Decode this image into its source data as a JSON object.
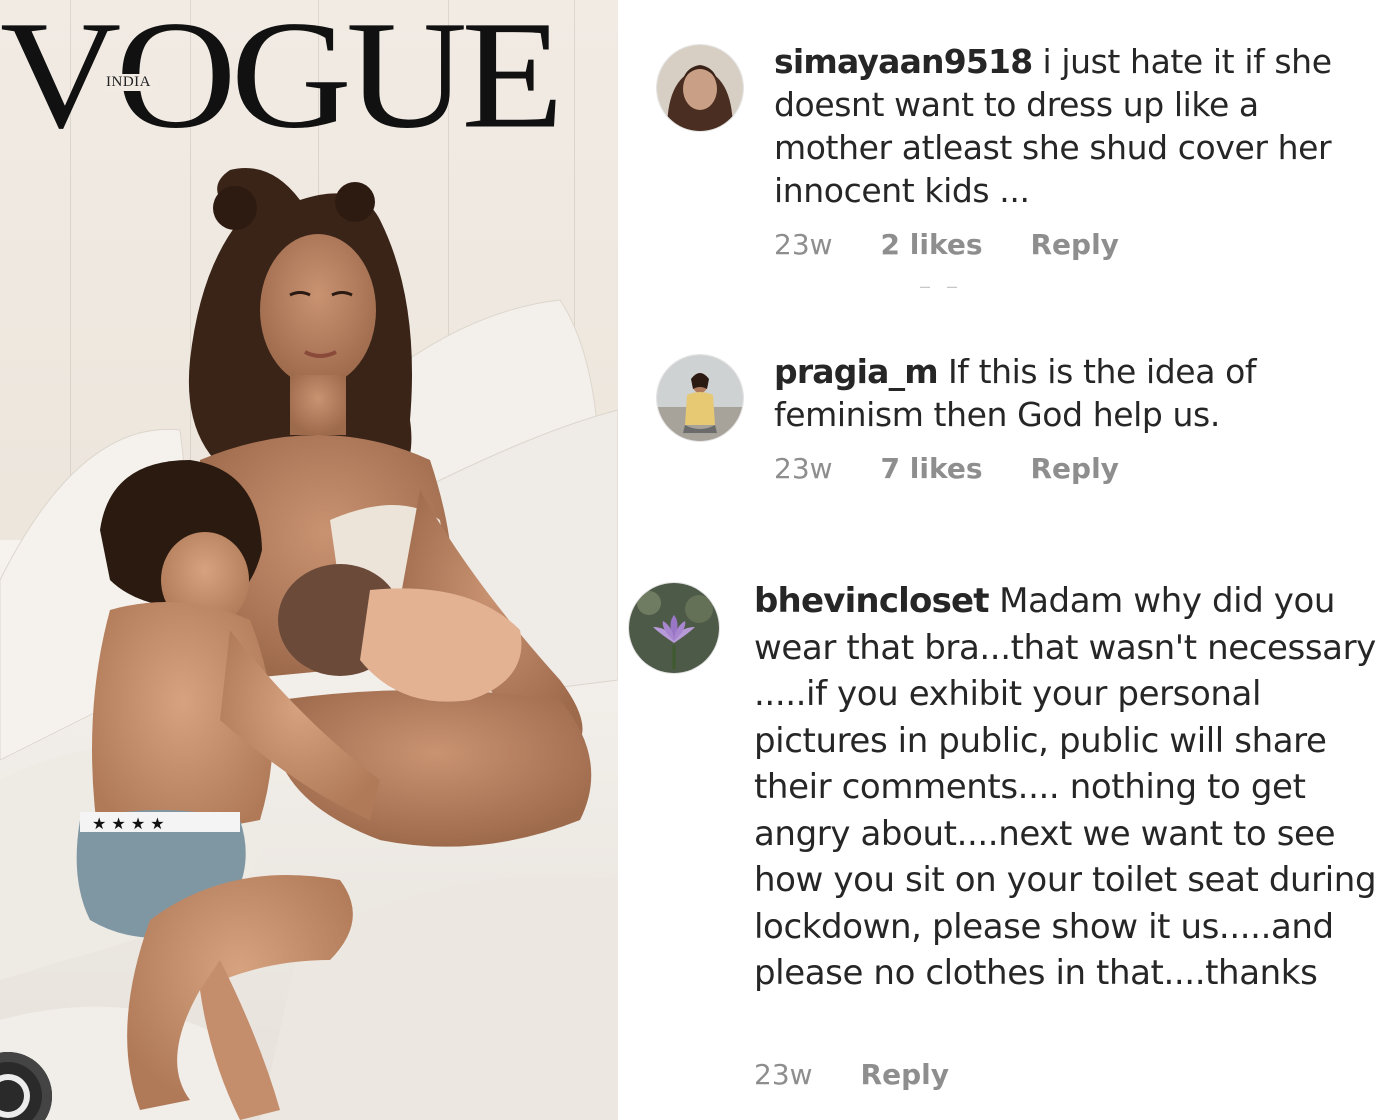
{
  "cover": {
    "masthead": "VOGUE",
    "edition": "INDIA"
  },
  "comments": [
    {
      "username": "simayaan9518",
      "text": "i just hate it if she doesnt want to dress up like a mother atleast she shud cover her innocent kids ...",
      "time": "23w",
      "likes": "2 likes",
      "reply": "Reply"
    },
    {
      "username": "pragia_m",
      "text": "If this is the idea of feminism then God help us.",
      "time": "23w",
      "likes": "7 likes",
      "reply": "Reply"
    },
    {
      "username": "bhevincloset",
      "text": "Madam why did you wear that bra...that wasn't necessary .....if you exhibit your personal pictures in public, public will share their comments.... nothing to get angry about....next we want to see how you sit on your toilet seat during lockdown, please show it us.....and please no clothes in that....thanks",
      "time": "23w",
      "reply": "Reply"
    }
  ],
  "colors": {
    "text": "#262626",
    "muted": "#8e8e8e",
    "background": "#ffffff"
  }
}
